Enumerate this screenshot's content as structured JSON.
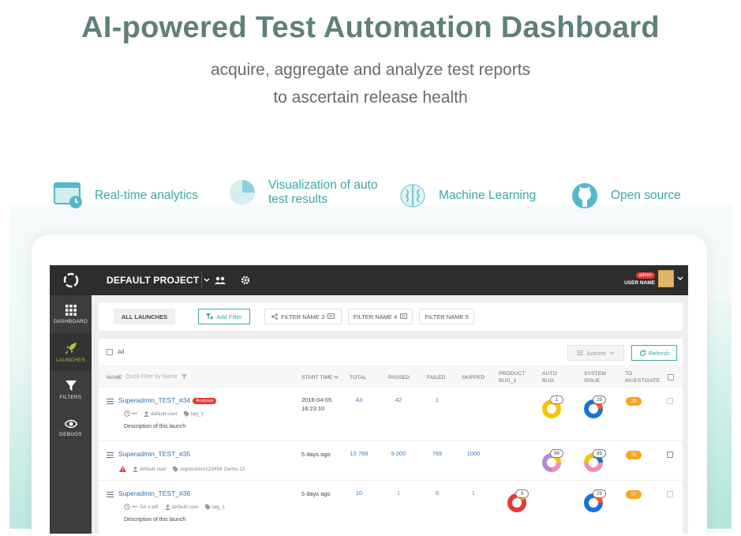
{
  "hero": {
    "title": "AI-powered Test Automation Dashboard",
    "subtitle_line1": "acquire, aggregate and analyze test reports",
    "subtitle_line2": "to ascertain release health"
  },
  "features": [
    {
      "icon": "clock-dashboard-icon",
      "label": "Real-time analytics"
    },
    {
      "icon": "pie-chart-icon",
      "label_line1": "Visualization of auto",
      "label_line2": "test results"
    },
    {
      "icon": "brain-icon",
      "label": "Machine Learning"
    },
    {
      "icon": "github-icon",
      "label": "Open source"
    }
  ],
  "colors": {
    "accent": "#3aa8a5",
    "heading": "#5e807b",
    "topbar": "#2d2d2d",
    "sidebar": "#3d3d3d",
    "active": "#a2c73e",
    "link": "#2b6fb4"
  },
  "app": {
    "project": "DEFAULT PROJECT",
    "user": {
      "role": "admin",
      "name": "USER NAME"
    },
    "sidebar": [
      {
        "icon": "grid-icon",
        "label": "DASHBOARD"
      },
      {
        "icon": "rocket-icon",
        "label": "LAUNCHES",
        "active": true
      },
      {
        "icon": "funnel-icon",
        "label": "FILTERS"
      },
      {
        "icon": "eye-icon",
        "label": "DEBUGS"
      }
    ],
    "filters": {
      "all_launches": "ALL LAUNCHES",
      "add_filter": "Add Filter",
      "filter3": "FILTER NAME 3",
      "filter4": "FILTER NAME 4",
      "filter5": "FILTER NAME 5"
    },
    "toolbar": {
      "all": "All",
      "actions": "Actions",
      "refresh": "Refresh"
    },
    "columns": {
      "name": "NAME",
      "quick_filter": "Quick Filter by Name",
      "start_time": "START TIME",
      "total": "TOTAL",
      "passed": "PASSED",
      "failed": "FAILED",
      "skipped": "SKIPPED",
      "product_bug_1": "PRODUCT",
      "product_bug_2": "BUG_1",
      "auto_bug_1": "AUTO",
      "auto_bug_2": "BUG",
      "system_issue_1": "SYSTEM",
      "system_issue_2": "ISSUE",
      "to_investigate_1": "TO",
      "to_investigate_2": "INVESTIGATE"
    },
    "rows": [
      {
        "name": "Superadmin_TEST_#34",
        "badge": "Analysys",
        "meta_dots": "•••",
        "owner": "default user",
        "tag": "tag_1",
        "description": "Description of this launch",
        "start_date": "2016-04-05",
        "start_clock": "16:23:10",
        "total": "43",
        "passed": "42",
        "failed": "1",
        "skipped": "",
        "auto_bug": "1",
        "system_issue": "29",
        "to_investigate": "29"
      },
      {
        "name": "Superadmin_TEST_#35",
        "owner": "default user",
        "tag": "registration123456",
        "tag2": "Demo-12",
        "start": "5 days ago",
        "total": "10 789",
        "passed": "9 000",
        "failed": "789",
        "skipped": "1000",
        "auto_bug": "98",
        "system_issue": "89",
        "to_investigate": "76"
      },
      {
        "name": "Superadmin_TEST_#36",
        "meta_dots": "•••",
        "time_left": "-54 s left",
        "owner": "default user",
        "tag": "tag_1",
        "description": "Description of this launch",
        "start": "5 days ago",
        "total": "10",
        "passed": "1",
        "failed": "8",
        "skipped": "1",
        "product_bug": "9",
        "system_issue": "29",
        "to_investigate": "37"
      }
    ]
  }
}
